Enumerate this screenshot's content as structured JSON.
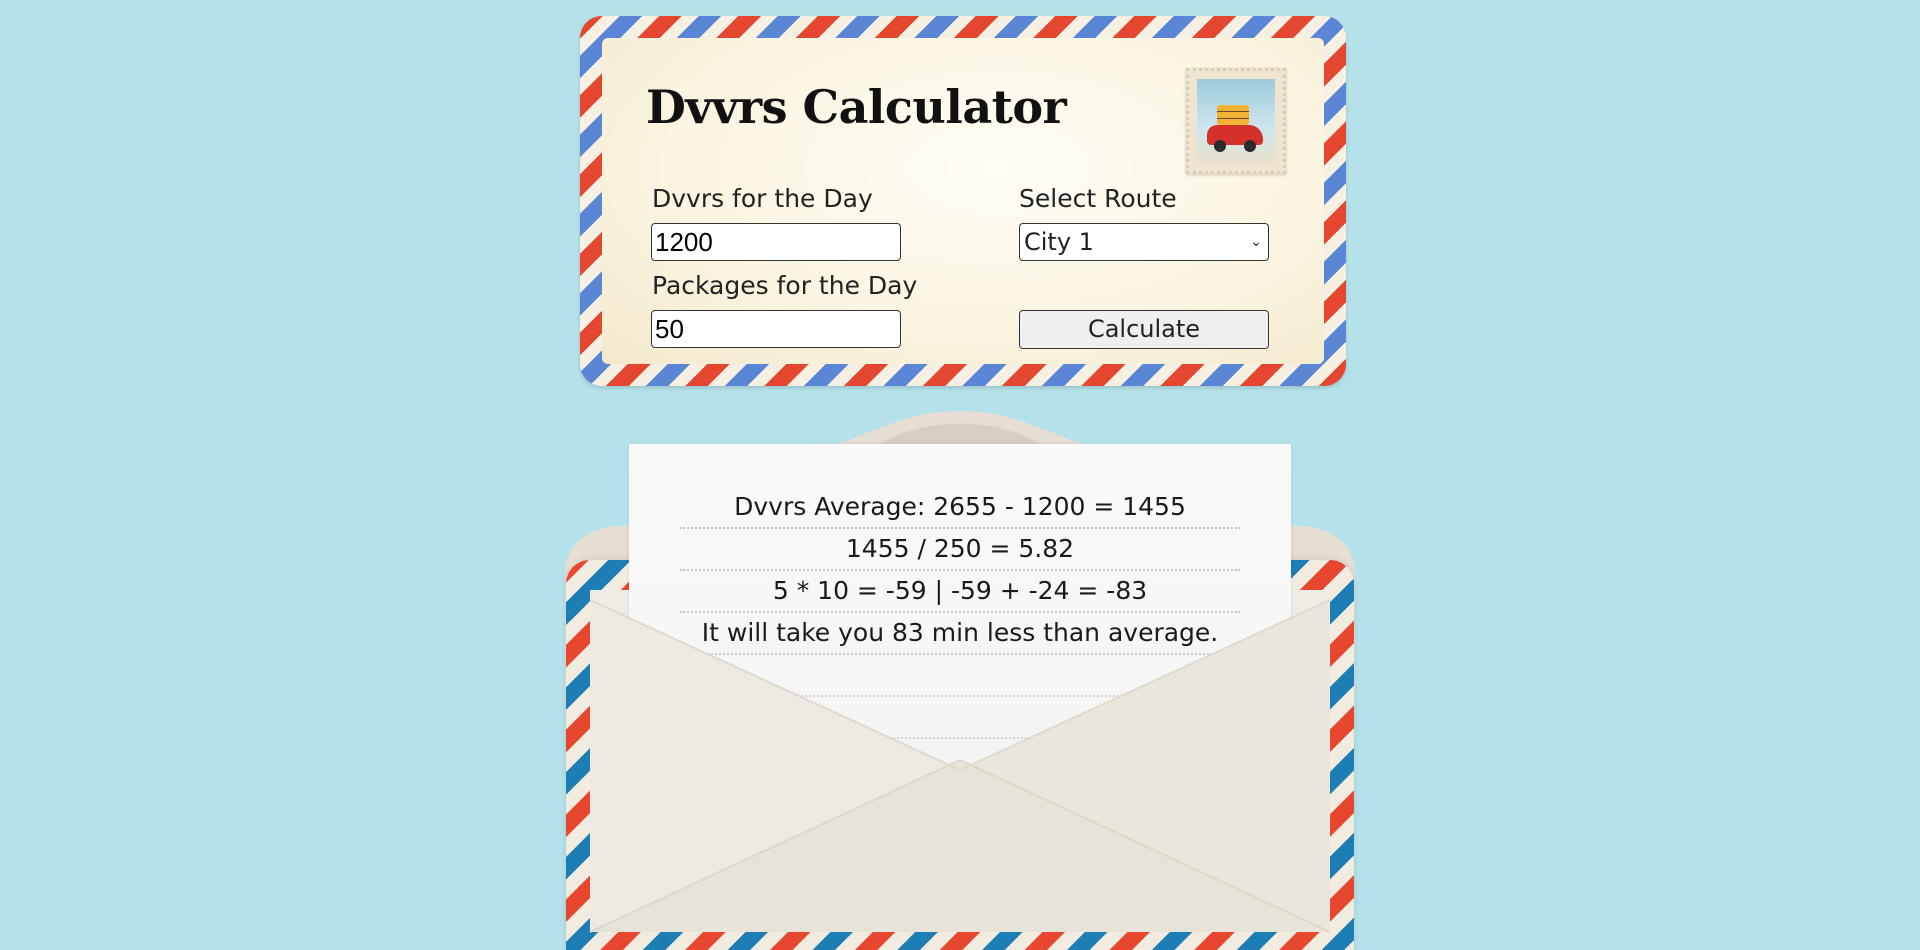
{
  "app": {
    "title": "Dvvrs Calculator"
  },
  "form": {
    "dvvrs_label": "Dvvrs for the Day",
    "dvvrs_value": "1200",
    "route_label": "Select Route",
    "route_selected": "City 1",
    "packages_label": "Packages for the Day",
    "packages_value": "50",
    "calculate_label": "Calculate"
  },
  "result": {
    "lines": [
      "Dvvrs Average: 2655 - 1200 = 1455",
      "1455 / 250 = 5.82",
      "5 * 10 = -59 | -59 + -24 = -83",
      "It will take you 83 min less than average."
    ]
  },
  "colors": {
    "background": "#b5e2ea",
    "airmail_red": "#e4462f",
    "airmail_blue": "#5b86d6",
    "envelope_blue": "#1d7db5",
    "card_paper": "#fbf5e2"
  },
  "icons": {
    "stamp": "postage-stamp-car-icon",
    "dropdown": "chevron-down-icon"
  }
}
